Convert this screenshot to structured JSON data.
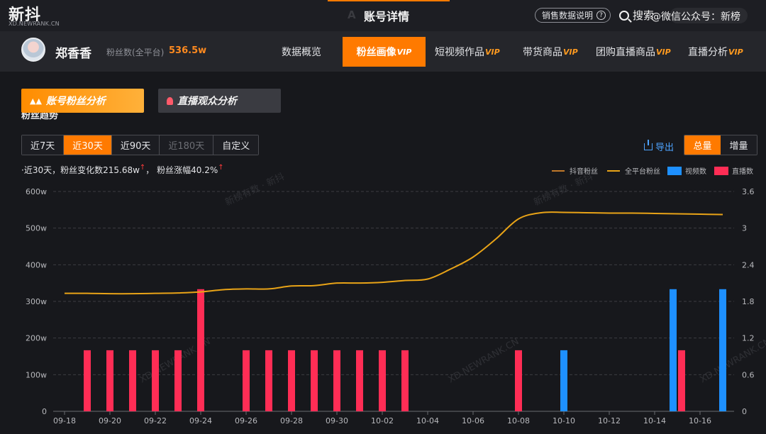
{
  "header": {
    "logo": "新抖",
    "logo_sub": "XD.NEWRANK.CN",
    "title_ghost": "A                    T",
    "page_title": "账号详情",
    "sales_help": "销售数据说明",
    "help_icon": "?",
    "search_label": "搜索",
    "wechat_watermark": "@微信公众号：新榜"
  },
  "account": {
    "name": "郑香香",
    "fans_label": "粉丝数(全平台)",
    "fans_value": "536.5w"
  },
  "nav": [
    {
      "label": "数据概览",
      "vip": ""
    },
    {
      "label": "粉丝画像",
      "vip": "VIP"
    },
    {
      "label": "短视频作品",
      "vip": "VIP"
    },
    {
      "label": "带货商品",
      "vip": "VIP"
    },
    {
      "label": "团购直播商品",
      "vip": "VIP"
    },
    {
      "label": "直播分析",
      "vip": "VIP"
    }
  ],
  "subtabs": {
    "fans_analysis": "账号粉丝分析",
    "live_audience": "直播观众分析",
    "fans_icon": "▲▲"
  },
  "section_title": "粉丝趋势",
  "range_buttons": [
    "近7天",
    "近30天",
    "近90天",
    "近180天",
    "自定义"
  ],
  "export_label": "导出",
  "mode_buttons": [
    "总量",
    "增量"
  ],
  "summary": {
    "prefix": "·近30天，粉丝变化数",
    "change": "215.68w",
    "middle": "，  粉丝涨幅",
    "rate": "40.2%",
    "arrow": "↑"
  },
  "chart_data": {
    "type": "bar+line",
    "legend": [
      "抖音粉丝",
      "全平台粉丝",
      "视频数",
      "直播数"
    ],
    "legend_position": "top-right",
    "colors": {
      "douyin_fans": "#c0792a",
      "platform_fans": "#e8a317",
      "video": "#1e90ff",
      "live": "#ff2d55",
      "grid": "#3c3d42",
      "tick": "#b8b9bd"
    },
    "watermarks": [
      "新榜有数 · 新抖",
      "新榜有数 · 新抖",
      "XD.NEWRANK.CN",
      "XD.NEWRANK.CN",
      "XD.NEWRANK.CN"
    ],
    "dates": [
      "09-18",
      "09-19",
      "09-20",
      "09-21",
      "09-22",
      "09-23",
      "09-24",
      "09-25",
      "09-26",
      "09-27",
      "09-28",
      "09-29",
      "09-30",
      "10-01",
      "10-02",
      "10-03",
      "10-04",
      "10-05",
      "10-06",
      "10-07",
      "10-08",
      "10-09",
      "10-10",
      "10-11",
      "10-12",
      "10-13",
      "10-14",
      "10-15",
      "10-16",
      "10-17"
    ],
    "x_tick_labels": [
      "09-18",
      "09-20",
      "09-22",
      "09-24",
      "09-26",
      "09-28",
      "09-30",
      "10-02",
      "10-04",
      "10-06",
      "10-08",
      "10-10",
      "10-12",
      "10-14",
      "10-16"
    ],
    "y_left": {
      "ticks": [
        "0",
        "100w",
        "200w",
        "300w",
        "400w",
        "500w",
        "600w"
      ],
      "min": 0,
      "max": 600,
      "unit": "w"
    },
    "y_right": {
      "ticks": [
        "0",
        "0.6",
        "1.2",
        "1.8",
        "2.4",
        "3",
        "3.6"
      ],
      "min": 0,
      "max": 3.6
    },
    "grid": true,
    "series": [
      {
        "name": "全平台粉丝",
        "type": "line",
        "axis": "left",
        "values": [
          322,
          322,
          321,
          321,
          322,
          323,
          326,
          332,
          334,
          334,
          342,
          343,
          350,
          350,
          352,
          357,
          361,
          388,
          421,
          470,
          525,
          542,
          543,
          542,
          541,
          541,
          540,
          539,
          538,
          537
        ]
      },
      {
        "name": "视频数",
        "type": "bar",
        "axis": "right",
        "values": [
          0,
          0,
          0,
          0,
          0,
          0,
          0,
          0,
          0,
          0,
          0,
          0,
          0,
          0,
          0,
          0,
          0,
          0,
          0,
          0,
          0,
          0,
          1,
          0,
          0,
          0,
          0,
          2,
          0,
          2
        ]
      },
      {
        "name": "直播数",
        "type": "bar",
        "axis": "right",
        "values": [
          0,
          1,
          1,
          1,
          1,
          1,
          2,
          0,
          1,
          1,
          1,
          1,
          1,
          1,
          1,
          1,
          0,
          0,
          0,
          0,
          1,
          0,
          0,
          0,
          0,
          0,
          0,
          1,
          0,
          0
        ]
      }
    ]
  }
}
